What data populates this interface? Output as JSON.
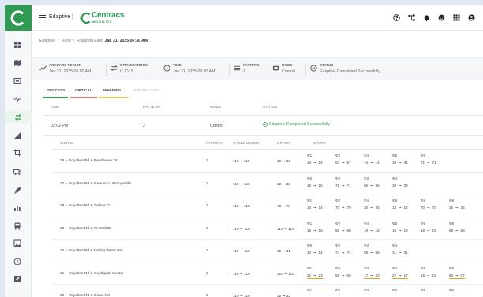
{
  "colors": {
    "brand_green": "#2e9a52",
    "success": "#3a9b58",
    "critical": "#e07b7b",
    "warning": "#e8c45a"
  },
  "header": {
    "org_name": "Edaptive |",
    "brand_name": "Centracs",
    "brand_tagline": "MOBILITY"
  },
  "top_icons": [
    "help-icon",
    "network-icon",
    "bell-icon",
    "face-icon",
    "grid-icon",
    "user-icon"
  ],
  "sidebar_icons": [
    "dashboard-icon",
    "map-icon",
    "monitor-icon",
    "pulse-icon",
    "routes-icon",
    "signal-icon",
    "crop-icon",
    "vehicle-icon",
    "rocket-icon",
    "chart-icon",
    "bus-icon",
    "image-icon",
    "clock-icon",
    "edit-icon"
  ],
  "breadcrumb": {
    "root": "Edaptive",
    "section": "Runs",
    "item": "Royalton East",
    "current": "Jan 31, 2025 06:30 AM"
  },
  "info": {
    "analysis_period": {
      "label": "ANALYSIS PERIOD",
      "value": "Jan 31, 2025 06:30 AM"
    },
    "optimizations": {
      "label": "OPTIMIZATIONS",
      "value": "C, O, S"
    },
    "time": {
      "label": "TIME",
      "value": "Jan 31, 2025 06:30 AM"
    },
    "pattern": {
      "label": "PATTERN",
      "value": "2"
    },
    "mode": {
      "label": "MODE",
      "value": "Control"
    },
    "status": {
      "label": "STATUS",
      "value": "Edaptive Completed Successfully"
    }
  },
  "tabs": [
    "SUCCESS",
    "CRITICAL",
    "WARNING",
    "INFORMATION"
  ],
  "table": {
    "headers": [
      "TIME",
      "PATTERN",
      "MODE",
      "STATUS"
    ],
    "row": {
      "time": "02:02 PM",
      "pattern": "2",
      "mode": "Control",
      "status": "Edaptive Completed Successfully"
    }
  },
  "subtable": {
    "headers": [
      "SIGNAL",
      "PATTERN",
      "CYCLE LENGTH",
      "OFFSET",
      "SPLITS"
    ],
    "rows": [
      {
        "signal": "26 – Royalton Rd & Pearleview Dr",
        "pattern": "2",
        "cycle": [
          "119",
          "119"
        ],
        "offset": [
          "62",
          "62"
        ],
        "splits": [
          {
            "p": "Φ1",
            "a": "14",
            "b": "14"
          },
          {
            "p": "Φ2",
            "a": "57",
            "b": "57"
          },
          {
            "p": "Φ4",
            "a": "14",
            "b": "14"
          },
          {
            "p": "Φ5",
            "a": "34",
            "b": "34"
          },
          {
            "p": "Φ6",
            "a": "71",
            "b": "71"
          }
        ]
      },
      {
        "signal": "27 – Royalton Rd & Greens of Strongsville",
        "pattern": "2",
        "cycle": [
          "119",
          "119"
        ],
        "offset": [
          "32",
          "32"
        ],
        "splits": [
          {
            "p": "Φ5",
            "a": "15",
            "b": "15"
          },
          {
            "p": "Φ6",
            "a": "71",
            "b": "71"
          },
          {
            "p": "Φ2",
            "a": "86",
            "b": "86"
          },
          {
            "p": "Φ4",
            "a": "33",
            "b": "33"
          }
        ]
      },
      {
        "signal": "28 – Royalton Rd & Ordnor Dr",
        "pattern": "2",
        "cycle": [
          "119",
          "119"
        ],
        "offset": [
          "78",
          "78"
        ],
        "splits": [
          {
            "p": "Φ1",
            "a": "14",
            "b": "14"
          },
          {
            "p": "Φ2",
            "a": "70",
            "b": "70"
          },
          {
            "p": "Φ4",
            "a": "35",
            "b": "35"
          },
          {
            "p": "Φ5",
            "a": "14",
            "b": "14"
          },
          {
            "p": "Φ6",
            "a": "70",
            "b": "70"
          },
          {
            "p": "Φ8",
            "a": "35",
            "b": "35"
          }
        ]
      },
      {
        "signal": "29 – Royalton Rd & W. Mall Dr",
        "pattern": "2",
        "cycle": [
          "119",
          "119"
        ],
        "offset": [
          "113",
          "113"
        ],
        "splits": [
          {
            "p": "Φ1",
            "a": "15",
            "b": "15"
          },
          {
            "p": "Φ2",
            "a": "68",
            "b": "68"
          },
          {
            "p": "Φ4",
            "a": "18",
            "b": "18"
          },
          {
            "p": "Φ5",
            "a": "18",
            "b": "18"
          },
          {
            "p": "Φ6",
            "a": "15",
            "b": "15"
          },
          {
            "p": "Φ8",
            "a": "68",
            "b": "68"
          }
        ]
      },
      {
        "signal": "30 – Royalton Rd & Falling Water Rd",
        "pattern": "2",
        "cycle": [
          "119",
          "119"
        ],
        "offset": [
          "41",
          "41"
        ],
        "splits": [
          {
            "p": "Φ5",
            "a": "14",
            "b": "14"
          },
          {
            "p": "Φ6",
            "a": "74",
            "b": "74"
          },
          {
            "p": "Φ2",
            "a": "88",
            "b": "88"
          },
          {
            "p": "Φ4",
            "a": "31",
            "b": "31"
          }
        ]
      },
      {
        "signal": "31 – Royalton Rd & Southpark Center",
        "pattern": "2",
        "cycle": [
          "119",
          "119"
        ],
        "offset": [
          "103",
          "103"
        ],
        "splits": [
          {
            "p": "Φ1",
            "a": "21",
            "b": "23",
            "warn": true
          },
          {
            "p": "Φ2",
            "a": "59",
            "b": "58"
          },
          {
            "p": "Φ3",
            "a": "17",
            "b": "20",
            "warn": true
          },
          {
            "p": "Φ4",
            "a": "22",
            "b": "17",
            "warn": true
          },
          {
            "p": "Φ5",
            "a": "15",
            "b": "15"
          },
          {
            "p": "Φ6",
            "a": "65",
            "b": "67",
            "warn": true
          }
        ]
      },
      {
        "signal": "32 – Royalton Rd & Howe Rd",
        "pattern": "2",
        "cycle": [
          "119",
          "119"
        ],
        "offset": [
          "32",
          "32"
        ],
        "splits": [
          {
            "p": "Φ1",
            "a": "",
            "b": ""
          },
          {
            "p": "Φ2",
            "a": "",
            "b": ""
          },
          {
            "p": "Φ3",
            "a": "",
            "b": ""
          },
          {
            "p": "Φ4",
            "a": "",
            "b": ""
          },
          {
            "p": "Φ5",
            "a": "",
            "b": ""
          },
          {
            "p": "Φ6",
            "a": "",
            "b": ""
          }
        ]
      }
    ]
  }
}
